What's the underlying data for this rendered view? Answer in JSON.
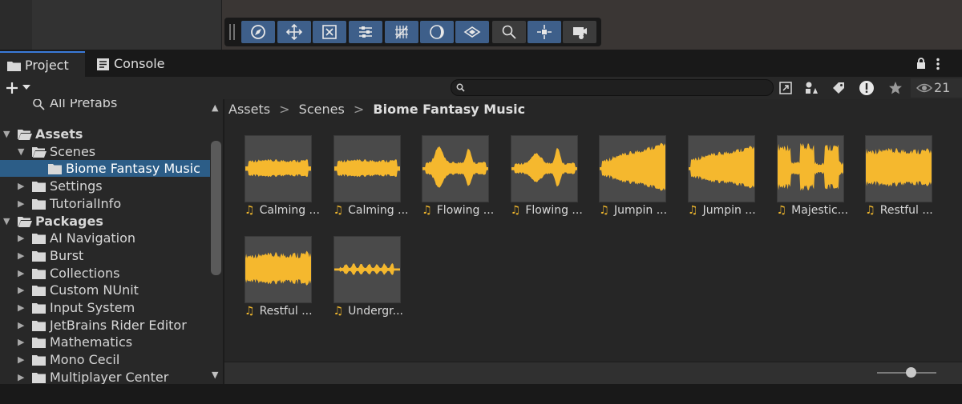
{
  "tabs": [
    {
      "label": "Project",
      "icon": "folder-icon",
      "active": true
    },
    {
      "label": "Console",
      "icon": "console-icon",
      "active": false
    }
  ],
  "toolbar_tools": [
    "view-tool-icon",
    "move-tool-icon",
    "rect-transform-icon",
    "align-icon",
    "grid-snap-icon",
    "lighting-icon",
    "layers-icon",
    "search-icon",
    "pivot-icon",
    "camera-icon"
  ],
  "toolbar2": {
    "search_placeholder": "",
    "hidden_count": "21"
  },
  "tree": {
    "partial_top": "All Prefabs",
    "items": [
      {
        "label": "Assets",
        "bold": true,
        "expanded": true,
        "level": 0
      },
      {
        "label": "Scenes",
        "expanded": true,
        "level": 1
      },
      {
        "label": "Biome Fantasy Music",
        "selected": true,
        "level": 2
      },
      {
        "label": "Settings",
        "level": 1
      },
      {
        "label": "TutorialInfo",
        "level": 1
      },
      {
        "label": "Packages",
        "bold": true,
        "expanded": true,
        "level": 0
      },
      {
        "label": "AI Navigation",
        "level": 1
      },
      {
        "label": "Burst",
        "level": 1
      },
      {
        "label": "Collections",
        "level": 1
      },
      {
        "label": "Custom NUnit",
        "level": 1
      },
      {
        "label": "Input System",
        "level": 1
      },
      {
        "label": "JetBrains Rider Editor",
        "level": 1
      },
      {
        "label": "Mathematics",
        "level": 1
      },
      {
        "label": "Mono Cecil",
        "level": 1
      },
      {
        "label": "Multiplayer Center",
        "level": 1
      }
    ]
  },
  "breadcrumb": {
    "parts": [
      "Assets",
      "Scenes",
      "Biome Fantasy Music"
    ],
    "separator": ">"
  },
  "assets": [
    {
      "name": "Calming ...",
      "wave": "flat"
    },
    {
      "name": "Calming ...",
      "wave": "flat"
    },
    {
      "name": "Flowing ...",
      "wave": "peak"
    },
    {
      "name": "Flowing ...",
      "wave": "peak2"
    },
    {
      "name": "Jumpin ...",
      "wave": "rise"
    },
    {
      "name": "Jumpin ...",
      "wave": "rise2"
    },
    {
      "name": "Majestic...",
      "wave": "bursts"
    },
    {
      "name": "Restful ...",
      "wave": "full"
    },
    {
      "name": "Restful ...",
      "wave": "full2"
    },
    {
      "name": "Undergr...",
      "wave": "pulses"
    }
  ],
  "zoom_level": 0.58,
  "colors": {
    "accent": "#3a7ad9",
    "selection": "#2c5d87",
    "waveform": "#f5b82e",
    "tool_active": "#3e5f8a"
  }
}
